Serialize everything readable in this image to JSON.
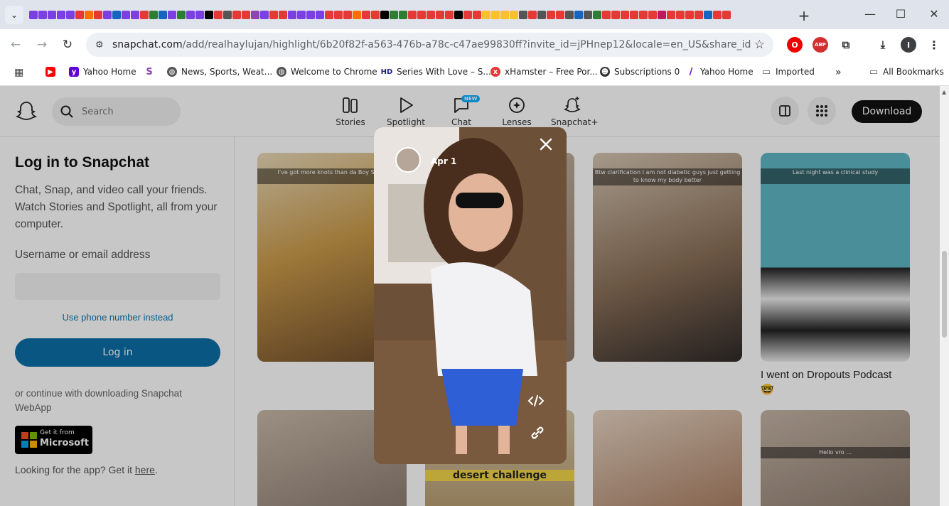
{
  "browser": {
    "url_host": "snapchat.com",
    "url_path": "/add/realhaylujan/highlight/6b20f82f-a563-476b-a78c-c47ae99830ff?invite_id=jPHnep12&locale=en_US&share_id=25pj_JcuQ7...",
    "bookmarks": [
      {
        "label": "",
        "icon": "youtube-icon",
        "color": "#ff0000"
      },
      {
        "label": "Yahoo Home",
        "icon": "yahoo-icon",
        "color": "#6001d2"
      },
      {
        "label": "",
        "icon": "s-icon",
        "color": "#8e44ad"
      },
      {
        "label": "News, Sports, Weat...",
        "icon": "globe-icon",
        "color": "#555555"
      },
      {
        "label": "Welcome to Chrome",
        "icon": "globe-icon",
        "color": "#555555"
      },
      {
        "label": "Series With Love – S...",
        "icon": "hd-icon",
        "color": "#1a237e"
      },
      {
        "label": "xHamster – Free Por...",
        "icon": "xhamster-icon",
        "color": "#e53935"
      },
      {
        "label": "Subscriptions 0",
        "icon": "mask-icon",
        "color": "#333333"
      },
      {
        "label": "Yahoo Home",
        "icon": "yahoo-icon",
        "color": "#6001d2"
      },
      {
        "label": "Imported",
        "icon": "folder-icon",
        "color": "#5f6368"
      }
    ],
    "all_bookmarks": "All Bookmarks",
    "more": "»",
    "profile_initial": "I"
  },
  "header": {
    "search_placeholder": "Search",
    "nav": [
      {
        "label": "Stories",
        "icon": "stories-icon"
      },
      {
        "label": "Spotlight",
        "icon": "play-icon"
      },
      {
        "label": "Chat",
        "icon": "chat-icon",
        "badge": "NEW"
      },
      {
        "label": "Lenses",
        "icon": "lens-icon"
      },
      {
        "label": "Snapchat+",
        "icon": "ghost-plus-icon"
      }
    ],
    "download": "Download"
  },
  "login": {
    "title": "Log in to Snapchat",
    "description": "Chat, Snap, and video call your friends. Watch Stories and Spotlight, all from your computer.",
    "username_label": "Username or email address",
    "username_value": "",
    "phone_link": "Use phone number instead",
    "login_button": "Log in",
    "continue_text": "or continue with downloading Snapchat WebApp",
    "ms_line1": "Get it from",
    "ms_line2": "Microsoft",
    "looking_text": "Looking for the app? Get it",
    "here_link": "here",
    "period": "."
  },
  "tiles": [
    {
      "caption": "I've got more knots than da Boy Sco..."
    },
    {
      "caption": ""
    },
    {
      "caption": "Btw clarification I am not diabetic guys just getting to know my body better"
    },
    {
      "caption": "Last night was a clinical study"
    },
    {
      "caption": ""
    },
    {
      "caption": "desert challenge"
    },
    {
      "caption": ""
    },
    {
      "caption": "Hello vro ..."
    }
  ],
  "story_caption": "I went on Dropouts Podcast",
  "viewer": {
    "date": "Apr 1"
  }
}
